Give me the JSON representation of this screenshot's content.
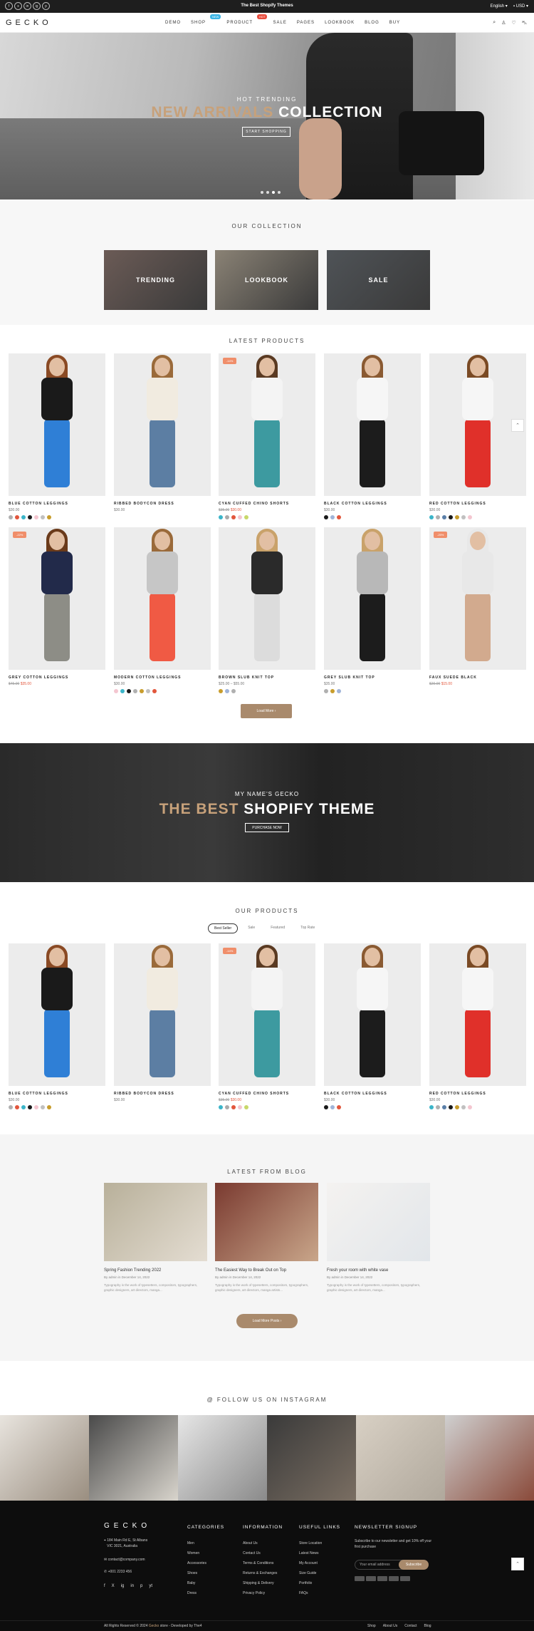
{
  "topbar": {
    "socials": [
      "f",
      "x",
      "in",
      "ig",
      "p"
    ],
    "promo": "The Best Shopify Themes",
    "language": "English",
    "currency": "USD"
  },
  "header": {
    "logo": "GECKO",
    "nav": [
      {
        "label": "DEMO",
        "badge": "",
        "badge_color": ""
      },
      {
        "label": "SHOP",
        "badge": "NEW",
        "badge_color": "#3bb5e6"
      },
      {
        "label": "PRODUCT",
        "badge": "HOT",
        "badge_color": "#e84c3d"
      },
      {
        "label": "SALE",
        "badge": "",
        "badge_color": ""
      },
      {
        "label": "PAGES",
        "badge": "",
        "badge_color": ""
      },
      {
        "label": "LOOKBOOK",
        "badge": "",
        "badge_color": ""
      },
      {
        "label": "BLOG",
        "badge": "",
        "badge_color": ""
      },
      {
        "label": "BUY",
        "badge": "",
        "badge_color": ""
      }
    ],
    "icons": [
      "search-icon",
      "user-icon",
      "heart-icon",
      "cart-icon"
    ]
  },
  "hero": {
    "subtitle": "HOT TRENDING",
    "title_gold": "NEW ARRIVALS",
    "title_white": "COLLECTION",
    "button": "START SHOPPING"
  },
  "collection": {
    "title": "OUR COLLECTION",
    "tiles": [
      {
        "label": "TRENDING",
        "color": "#6b5b56"
      },
      {
        "label": "LOOKBOOK",
        "color": "#8a8275"
      },
      {
        "label": "SALE",
        "color": "#4f5357"
      }
    ]
  },
  "latest": {
    "title": "LATEST PRODUCTS",
    "load_more": "Load More",
    "products": [
      {
        "name": "BLUE COTTON LEGGINGS",
        "price": "$30.00",
        "old_price": "",
        "new_price": "",
        "sale": "",
        "top": "#1a1a1a",
        "bottom": "#2f7fd6",
        "hair": "#8a4a24",
        "swatches": [
          "#b0b0b0",
          "#e2563c",
          "#3bb5c9",
          "#1a1a1a",
          "#f4c6d0",
          "#c0c0c0",
          "#c89d2c"
        ]
      },
      {
        "name": "RIBBED BODYCON DRESS",
        "price": "$30.00",
        "old_price": "",
        "new_price": "",
        "sale": "",
        "top": "#f1ebe0",
        "bottom": "#5c7ea3",
        "hair": "#9a6a3a",
        "swatches": []
      },
      {
        "name": "CYAN CUFFED CHINO SHORTS",
        "price": "",
        "old_price": "$35.00",
        "new_price": "$30.00",
        "sale": "-14%",
        "top": "#f4f4f4",
        "bottom": "#3d9aa0",
        "hair": "#5a3a22",
        "swatches": [
          "#3bb5c9",
          "#aaaaaa",
          "#e2563c",
          "#f4c6d0",
          "#c8d86a"
        ]
      },
      {
        "name": "BLACK COTTON LEGGINGS",
        "price": "$30.00",
        "old_price": "",
        "new_price": "",
        "sale": "",
        "top": "#f6f6f6",
        "bottom": "#1c1c1c",
        "hair": "#8a5a32",
        "swatches": [
          "#1a1a1a",
          "#a0b4d8",
          "#e2563c"
        ]
      },
      {
        "name": "RED COTTON LEGGINGS",
        "price": "$30.00",
        "old_price": "",
        "new_price": "",
        "sale": "",
        "top": "#f6f6f6",
        "bottom": "#e0302a",
        "hair": "#7a4a24",
        "swatches": [
          "#3bb5c9",
          "#b0b0b0",
          "#5a7fa8",
          "#1a1a1a",
          "#c89d2c",
          "#c0c0c0",
          "#f4c6d0"
        ]
      },
      {
        "name": "GREY COTTON LEGGINGS",
        "price": "",
        "old_price": "$45.00",
        "new_price": "$35.00",
        "sale": "-22%",
        "top": "#222a4a",
        "bottom": "#8d8d86",
        "hair": "#6a3a1a",
        "swatches": []
      },
      {
        "name": "MODERN COTTON LEGGINGS",
        "price": "$30.00",
        "old_price": "",
        "new_price": "",
        "sale": "",
        "top": "#c6c6c6",
        "bottom": "#f05a44",
        "hair": "#9a6a3a",
        "swatches": [
          "#f4c6d0",
          "#3bb5c9",
          "#1a1a1a",
          "#b0b0b0",
          "#c89d2c",
          "#c0c0c0",
          "#e2563c"
        ]
      },
      {
        "name": "BROWN SLUB KNIT TOP",
        "price": "$25.00 – $55.00",
        "old_price": "",
        "new_price": "",
        "sale": "",
        "top": "#2a2a2a",
        "bottom": "#dcdcdc",
        "hair": "#c9a26a",
        "swatches": [
          "#c89d2c",
          "#a0b4d8",
          "#b0b0b0"
        ]
      },
      {
        "name": "GREY SLUB KNIT TOP",
        "price": "$35.00",
        "old_price": "",
        "new_price": "",
        "sale": "",
        "top": "#b8b8b8",
        "bottom": "#1c1c1c",
        "hair": "#c9a26a",
        "swatches": [
          "#b0b0b0",
          "#c89d2c",
          "#a0b4d8"
        ]
      },
      {
        "name": "FAUX SUEDE BLACK",
        "price": "",
        "old_price": "$20.00",
        "new_price": "$15.00",
        "sale": "-25%",
        "top": "#e8e8e8",
        "bottom": "#d2aa8e",
        "hair": "#e8e8e8",
        "swatches": []
      }
    ]
  },
  "banner": {
    "subtitle": "MY NAME'S GECKO",
    "title_gold": "THE BEST",
    "title_white": "SHOPIFY THEME",
    "button": "PURCHASE NOW"
  },
  "ourproducts": {
    "title": "OUR PRODUCTS",
    "tabs": [
      "Best Seller",
      "Sale",
      "Featured",
      "Top Rate"
    ]
  },
  "blog": {
    "title": "LATEST FROM BLOG",
    "load_more": "Load More Posts",
    "posts": [
      {
        "title": "Spring Fashion Trending 2022",
        "meta": "By admin in December 14, 2022",
        "excerpt": "Typography is the work of typesetters, compositors, typographers, graphic designers, art directors, manga...",
        "c1": "#b8b09a",
        "c2": "#e4ddd2"
      },
      {
        "title": "The Easiest Way to Break Out on Top",
        "meta": "By admin in December 14, 2022",
        "excerpt": "Typography is the work of typesetters, compositors, typographers, graphic designers, art directors, manga artists...",
        "c1": "#7a3a30",
        "c2": "#c9a68a"
      },
      {
        "title": "Fresh your room with white vase",
        "meta": "By admin in December 14, 2022",
        "excerpt": "Typography is the work of typesetters, compositors, typographers, graphic designers, art directors, manga...",
        "c1": "#f4f2f0",
        "c2": "#e2e6ea"
      }
    ]
  },
  "instagram": {
    "title": "@ FOLLOW US ON INSTAGRAM",
    "colors": [
      [
        "#e8e4de",
        "#9a8e80"
      ],
      [
        "#4a4a4a",
        "#d8d4cc"
      ],
      [
        "#e6e6e6",
        "#8a8a8a"
      ],
      [
        "#3a3a3a",
        "#7a6e62"
      ],
      [
        "#d8d0c4",
        "#b0a89c"
      ],
      [
        "#cfcfcf",
        "#8a4a3a"
      ]
    ]
  },
  "footer": {
    "logo": "GECKO",
    "address": [
      "184 Main Rd E, St Albans",
      "VIC 3021, Australia"
    ],
    "email": "contact@company.com",
    "phone": "+001 2233 456",
    "social": [
      "f",
      "X",
      "ig",
      "in",
      "p",
      "yt"
    ],
    "columns": [
      {
        "title": "CATEGORIES",
        "items": [
          "Men",
          "Women",
          "Accessories",
          "Shoes",
          "Baby",
          "Dress"
        ]
      },
      {
        "title": "INFORMATION",
        "items": [
          "About Us",
          "Contact Us",
          "Terms & Conditions",
          "Returns & Exchanges",
          "Shipping & Delivery",
          "Privacy Policy"
        ]
      },
      {
        "title": "USEFUL LINKS",
        "items": [
          "Store Location",
          "Latest News",
          "My Account",
          "Size Guide",
          "Portfolio",
          "FAQs"
        ]
      }
    ],
    "newsletter_title": "NEWSLETTER SIGNUP",
    "newsletter_text": "Subscribe to our newsletter and get 10% off your first purchase",
    "email_placeholder": "Your email address",
    "subscribe": "Subscribe",
    "copyright_pre": "All Rights Reserved © 2024",
    "copyright_brand": "Gecko",
    "copyright_post": "store - Developed by The4",
    "bottom_links": [
      "Shop",
      "About Us",
      "Contact",
      "Blog"
    ]
  }
}
